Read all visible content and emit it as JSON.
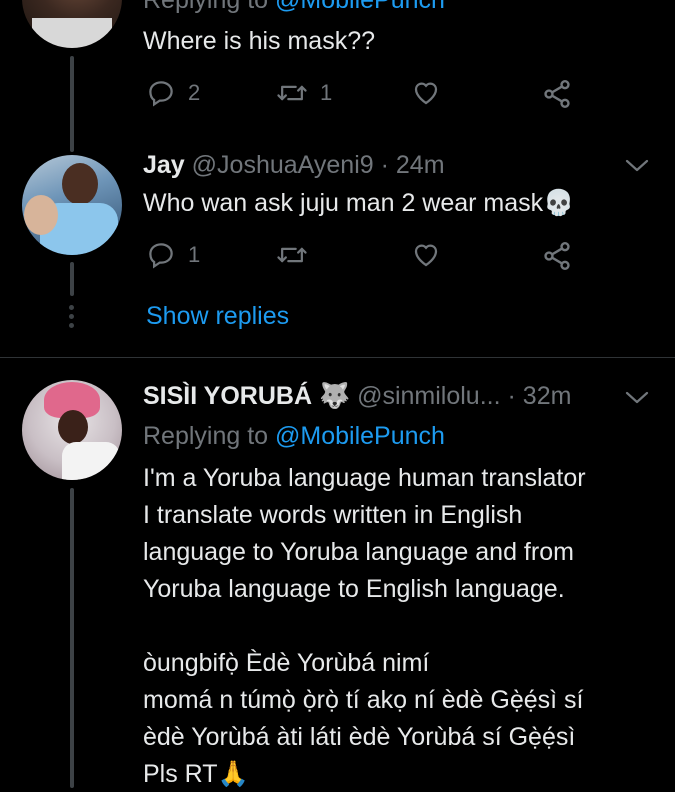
{
  "colors": {
    "background": "#000000",
    "text": "#e7e9ea",
    "muted": "#71767b",
    "link": "#1d9bf0"
  },
  "tweet1": {
    "replying_prefix": "Replying to ",
    "replying_handle": "@MobilePunch",
    "text": "Where is his mask??",
    "reply_count": "2",
    "retweet_count": "1",
    "icons": [
      "reply-icon",
      "retweet-icon",
      "like-icon",
      "share-icon"
    ]
  },
  "tweet2": {
    "name": "Jay",
    "handle": "@JoshuaAyeni9",
    "separator": "·",
    "time": "24m",
    "text": "Who wan ask juju man 2 wear mask",
    "emoji": "💀",
    "reply_count": "1",
    "show_replies": "Show replies"
  },
  "tweet3": {
    "name": "SISÌI YORUBÁ",
    "name_emoji": "🐺",
    "handle": "@sinmilolu...",
    "separator": "·",
    "time": "32m",
    "replying_prefix": "Replying to ",
    "replying_handle": "@MobilePunch",
    "lines": [
      "I'm a Yoruba language human translator",
      "I translate words written in English",
      "language to Yoruba language and from",
      "Yoruba language to English language.",
      "",
      "òungbifọ̀ Èdè Yorùbá nimí",
      "momá n túmọ̀ ọ̀rọ̀ tí akọ ní èdè Gẹ̀ẹ́sì sí",
      "èdè Yorùbá àti láti èdè Yorùbá sí Gẹ̀ẹ́sì",
      "Pls RT"
    ],
    "last_emoji": "🙏"
  }
}
